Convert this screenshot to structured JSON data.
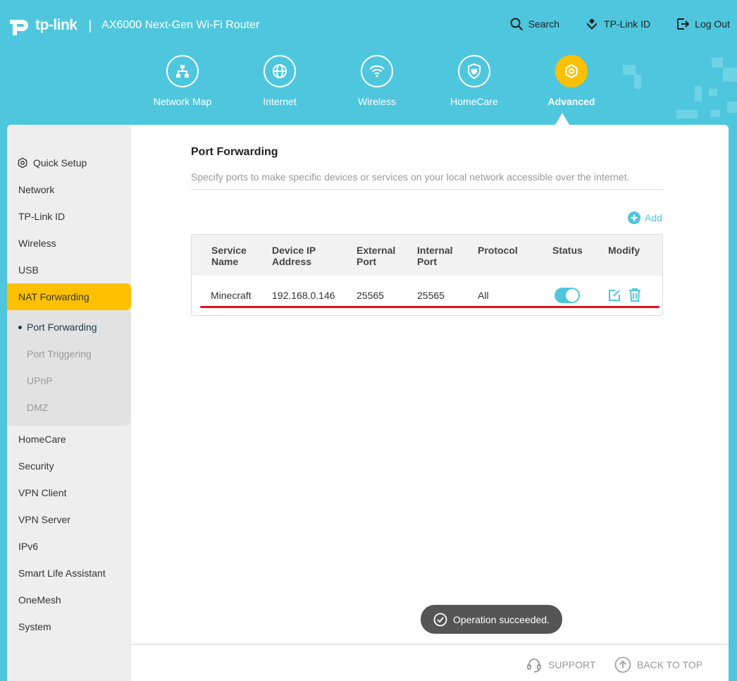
{
  "header": {
    "brand": "tp-link",
    "separator": "|",
    "product": "AX6000 Next-Gen Wi-Fi Router",
    "actions": [
      {
        "label": "Search",
        "icon": "search-icon"
      },
      {
        "label": "TP-Link ID",
        "icon": "tplink-id-icon"
      },
      {
        "label": "Log Out",
        "icon": "logout-icon"
      }
    ]
  },
  "nav": [
    {
      "label": "Network Map",
      "icon": "network-map-icon",
      "active": false
    },
    {
      "label": "Internet",
      "icon": "globe-icon",
      "active": false
    },
    {
      "label": "Wireless",
      "icon": "wifi-icon",
      "active": false
    },
    {
      "label": "HomeCare",
      "icon": "shield-icon",
      "active": false
    },
    {
      "label": "Advanced",
      "icon": "gear-icon",
      "active": true
    }
  ],
  "sidebar": {
    "items": [
      {
        "label": "Quick Setup",
        "icon": "gear-icon"
      },
      {
        "label": "Network"
      },
      {
        "label": "TP-Link ID"
      },
      {
        "label": "Wireless"
      },
      {
        "label": "USB"
      },
      {
        "label": "NAT Forwarding",
        "active": true
      },
      {
        "label": "HomeCare"
      },
      {
        "label": "Security"
      },
      {
        "label": "VPN Client"
      },
      {
        "label": "VPN Server"
      },
      {
        "label": "IPv6"
      },
      {
        "label": "Smart Life Assistant"
      },
      {
        "label": "OneMesh"
      },
      {
        "label": "System"
      }
    ],
    "subitems": [
      {
        "label": "Port Forwarding",
        "active": true
      },
      {
        "label": "Port Triggering"
      },
      {
        "label": "UPnP"
      },
      {
        "label": "DMZ"
      }
    ]
  },
  "main": {
    "title": "Port Forwarding",
    "description": "Specify ports to make specific devices or services on your local network accessible over the internet.",
    "add_label": "Add",
    "table": {
      "headers": {
        "service_1": "Service",
        "service_2": "Name",
        "ip_1": "Device IP",
        "ip_2": "Address",
        "ext_1": "External",
        "ext_2": "Port",
        "int_1": "Internal",
        "int_2": "Port",
        "protocol": "Protocol",
        "status": "Status",
        "modify": "Modify"
      },
      "rows": [
        {
          "service": "Minecraft",
          "ip": "192.168.0.146",
          "external": "25565",
          "internal": "25565",
          "protocol": "All",
          "status_on": true
        }
      ]
    }
  },
  "toast": "Operation succeeded.",
  "footer": {
    "support": "SUPPORT",
    "back_to_top": "BACK TO TOP"
  },
  "colors": {
    "header_bg": "#4ec7de",
    "accent": "#4ec6dd",
    "active": "#ffc000",
    "highlight_line": "#e30e1a"
  }
}
